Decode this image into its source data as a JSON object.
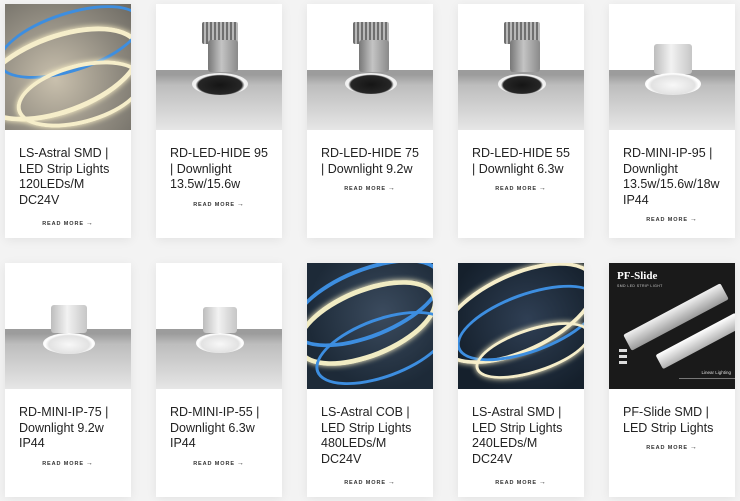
{
  "read_more_label": "READ MORE",
  "read_more_arrow": "→",
  "products": [
    {
      "title": "LS-Astral SMD | LED Strip Lights 120LEDs/M DC24V",
      "image": "led-strip-smd-warm"
    },
    {
      "title": "RD-LED-HIDE 95 | Downlight 13.5w/15.6w",
      "image": "recessed-downlight-black"
    },
    {
      "title": "RD-LED-HIDE 75 | Downlight 9.2w",
      "image": "recessed-downlight-black"
    },
    {
      "title": "RD-LED-HIDE 55 | Downlight 6.3w",
      "image": "recessed-downlight-black"
    },
    {
      "title": "RD-MINI-IP-95 | Downlight 13.5w/15.6w/18w IP44",
      "image": "recessed-downlight-white"
    },
    {
      "title": "RD-MINI-IP-75 | Downlight 9.2w IP44",
      "image": "recessed-downlight-white"
    },
    {
      "title": "RD-MINI-IP-55 | Downlight 6.3w IP44",
      "image": "recessed-downlight-white"
    },
    {
      "title": "LS-Astral COB | LED Strip Lights 480LEDs/M DC24V",
      "image": "led-strip-cob"
    },
    {
      "title": "LS-Astral SMD | LED Strip Lights 240LEDs/M DC24V",
      "image": "led-strip-smd-dark"
    },
    {
      "title": "PF-Slide SMD | LED Strip Lights",
      "image": "aluminium-profile"
    }
  ],
  "pf_image": {
    "title": "PF-Slide",
    "subtitle": "SMD LED STRIP LIGHT",
    "footer": "Linear Lighting"
  }
}
